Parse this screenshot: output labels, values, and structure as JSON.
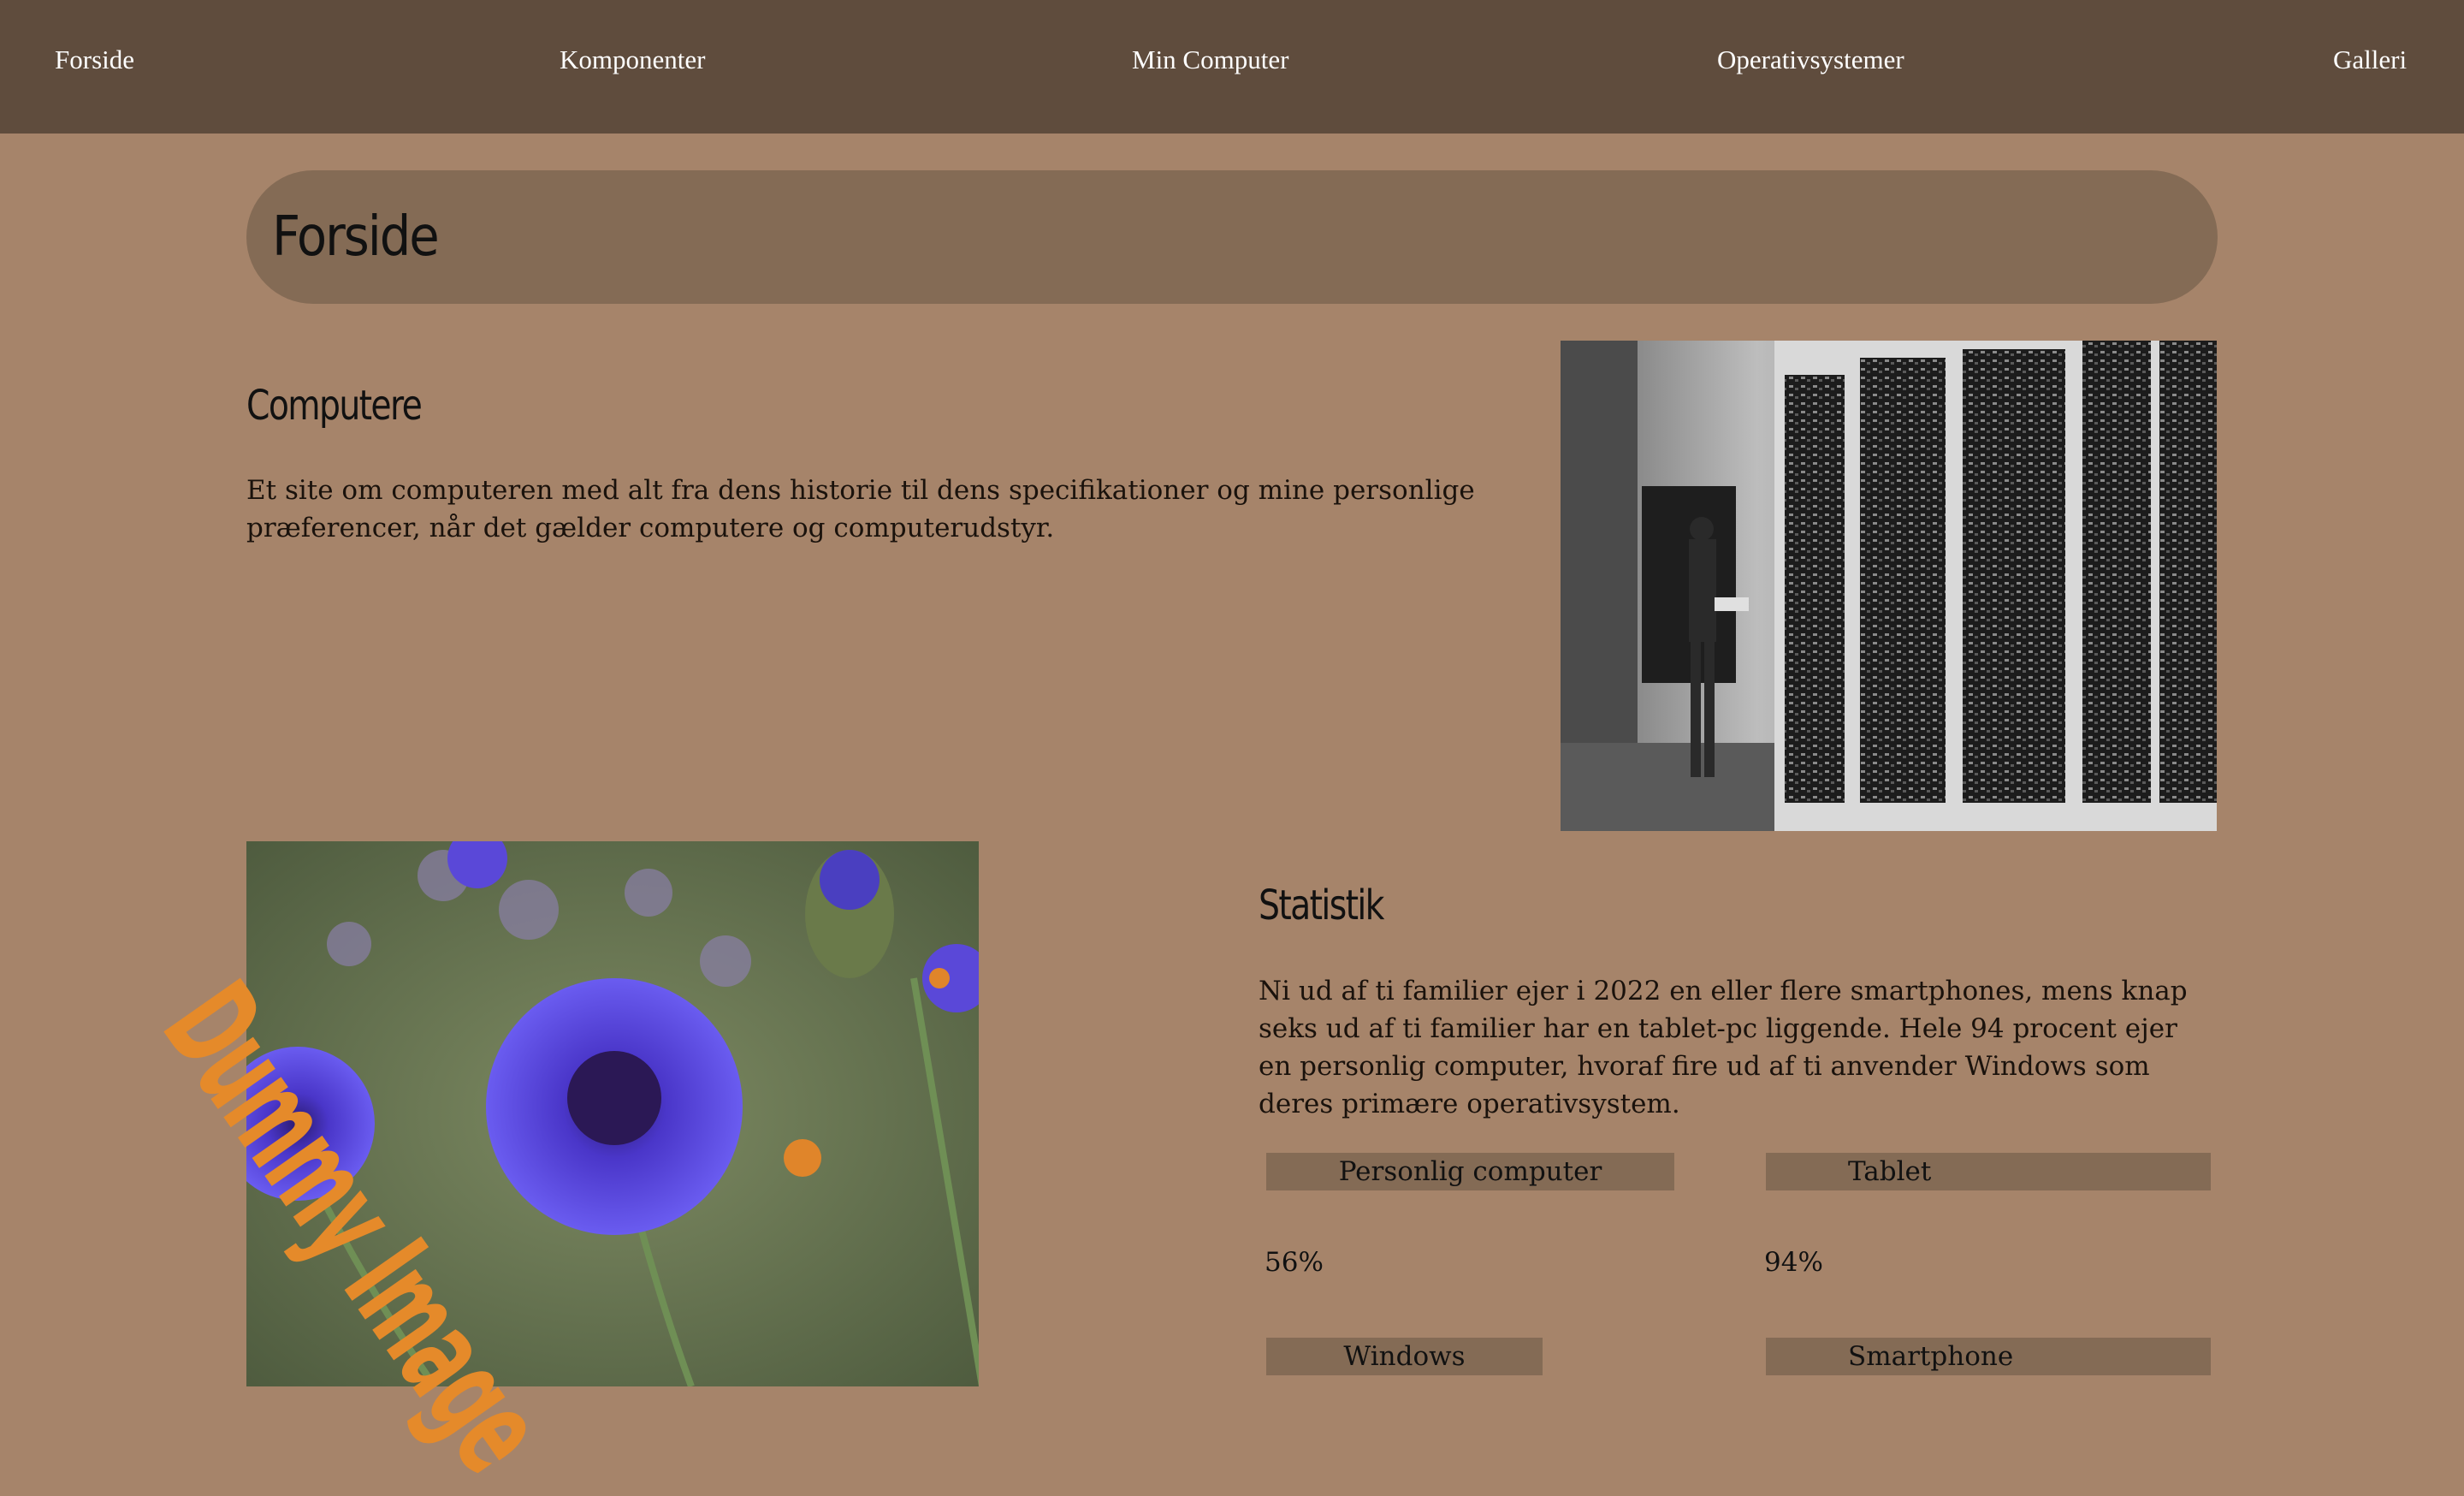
{
  "nav": {
    "items": [
      "Forside",
      "Komponenter",
      "Min Computer",
      "Operativsystemer",
      "Galleri"
    ]
  },
  "page": {
    "title": "Forside"
  },
  "intro": {
    "heading": "Computere",
    "text": "Et site om computeren med alt fra dens historie til dens specifikationer og mine personlige præferencer, når det gælder computere og computerudstyr."
  },
  "dummy_image": {
    "label": "Dummy Image"
  },
  "stats": {
    "heading": "Statistik",
    "text": "Ni ud af ti familier ejer i 2022 en eller flere smartphones, mens knap seks ud af ti familier har en tablet-pc liggende. Hele 94 procent ejer en personlig computer, hvoraf fire ud af ti anvender Windows som deres primære operativsystem.",
    "items": [
      {
        "label": "Personlig computer",
        "value": "56%"
      },
      {
        "label": "Tablet",
        "value": "94%"
      },
      {
        "label": "Windows",
        "value": ""
      },
      {
        "label": "Smartphone",
        "value": ""
      }
    ]
  },
  "colors": {
    "page_bg": "#a6846a",
    "nav_bg": "#5f4c3d",
    "banner_bg": "#846b55",
    "dummy_text": "#e58a2a"
  }
}
